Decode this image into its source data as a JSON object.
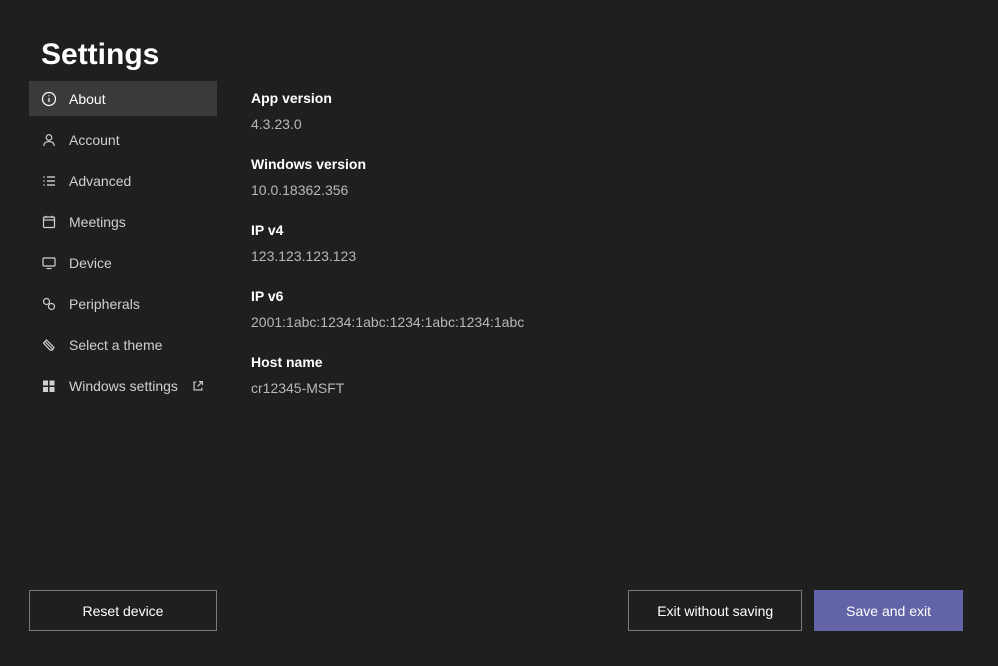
{
  "title": "Settings",
  "sidebar": {
    "items": [
      {
        "label": "About"
      },
      {
        "label": "Account"
      },
      {
        "label": "Advanced"
      },
      {
        "label": "Meetings"
      },
      {
        "label": "Device"
      },
      {
        "label": "Peripherals"
      },
      {
        "label": "Select a theme"
      },
      {
        "label": "Windows settings"
      }
    ]
  },
  "about": {
    "appVersion": {
      "label": "App version",
      "value": "4.3.23.0"
    },
    "windowsVersion": {
      "label": "Windows version",
      "value": "10.0.18362.356"
    },
    "ipv4": {
      "label": "IP v4",
      "value": "123.123.123.123"
    },
    "ipv6": {
      "label": "IP v6",
      "value": "2001:1abc:1234:1abc:1234:1abc:1234:1abc"
    },
    "hostName": {
      "label": "Host name",
      "value": "cr12345-MSFT"
    }
  },
  "footer": {
    "reset": "Reset device",
    "exit": "Exit without saving",
    "save": "Save and exit"
  }
}
